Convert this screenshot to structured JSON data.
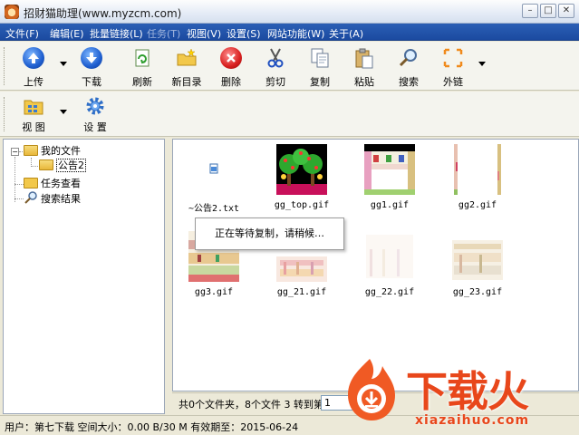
{
  "window": {
    "title": "招财猫助理(www.myzcm.com)",
    "min": "–",
    "max": "□",
    "close": "✕"
  },
  "menu": [
    {
      "label": "文件(F)",
      "disabled": false
    },
    {
      "label": "编辑(E)",
      "disabled": false
    },
    {
      "label": "批量链接(L)",
      "disabled": false
    },
    {
      "label": "任务(T)",
      "disabled": true
    },
    {
      "label": "视图(V)",
      "disabled": false
    },
    {
      "label": "设置(S)",
      "disabled": false
    },
    {
      "label": "网站功能(W)",
      "disabled": false
    },
    {
      "label": "关于(A)",
      "disabled": false
    }
  ],
  "toolbar": {
    "upload": "上传",
    "download": "下载",
    "refresh": "刷新",
    "new_folder": "新目录",
    "delete": "删除",
    "cut": "剪切",
    "copy": "复制",
    "paste": "粘贴",
    "search": "搜索",
    "external_link": "外链",
    "view": "视 图",
    "settings": "设 置"
  },
  "tree": {
    "root": "我的文件",
    "child": "公告2",
    "tasks": "任务查看",
    "search_results": "搜索结果",
    "expander": "−"
  },
  "files": [
    {
      "name": "~公告2.txt",
      "kind": "txt"
    },
    {
      "name": "gg_top.gif",
      "kind": "gif"
    },
    {
      "name": "gg1.gif",
      "kind": "gif"
    },
    {
      "name": "gg2.gif",
      "kind": "gif"
    },
    {
      "name": "gg3.gif",
      "kind": "gif"
    },
    {
      "name": "gg_21.gif",
      "kind": "gif"
    },
    {
      "name": "gg_22.gif",
      "kind": "gif"
    },
    {
      "name": "gg_23.gif",
      "kind": "gif"
    }
  ],
  "popup": {
    "message": "正在等待复制，请稍候…"
  },
  "file_status": {
    "summary": "共0个文件夹，8个文件 3 转到第",
    "page": "1"
  },
  "status": {
    "text": "用户：第七下载  空间大小：0.00 B/30 M  有效期至：2015-06-24"
  },
  "watermark": {
    "brand": "下载火",
    "url": "xiazaihuo.com"
  }
}
